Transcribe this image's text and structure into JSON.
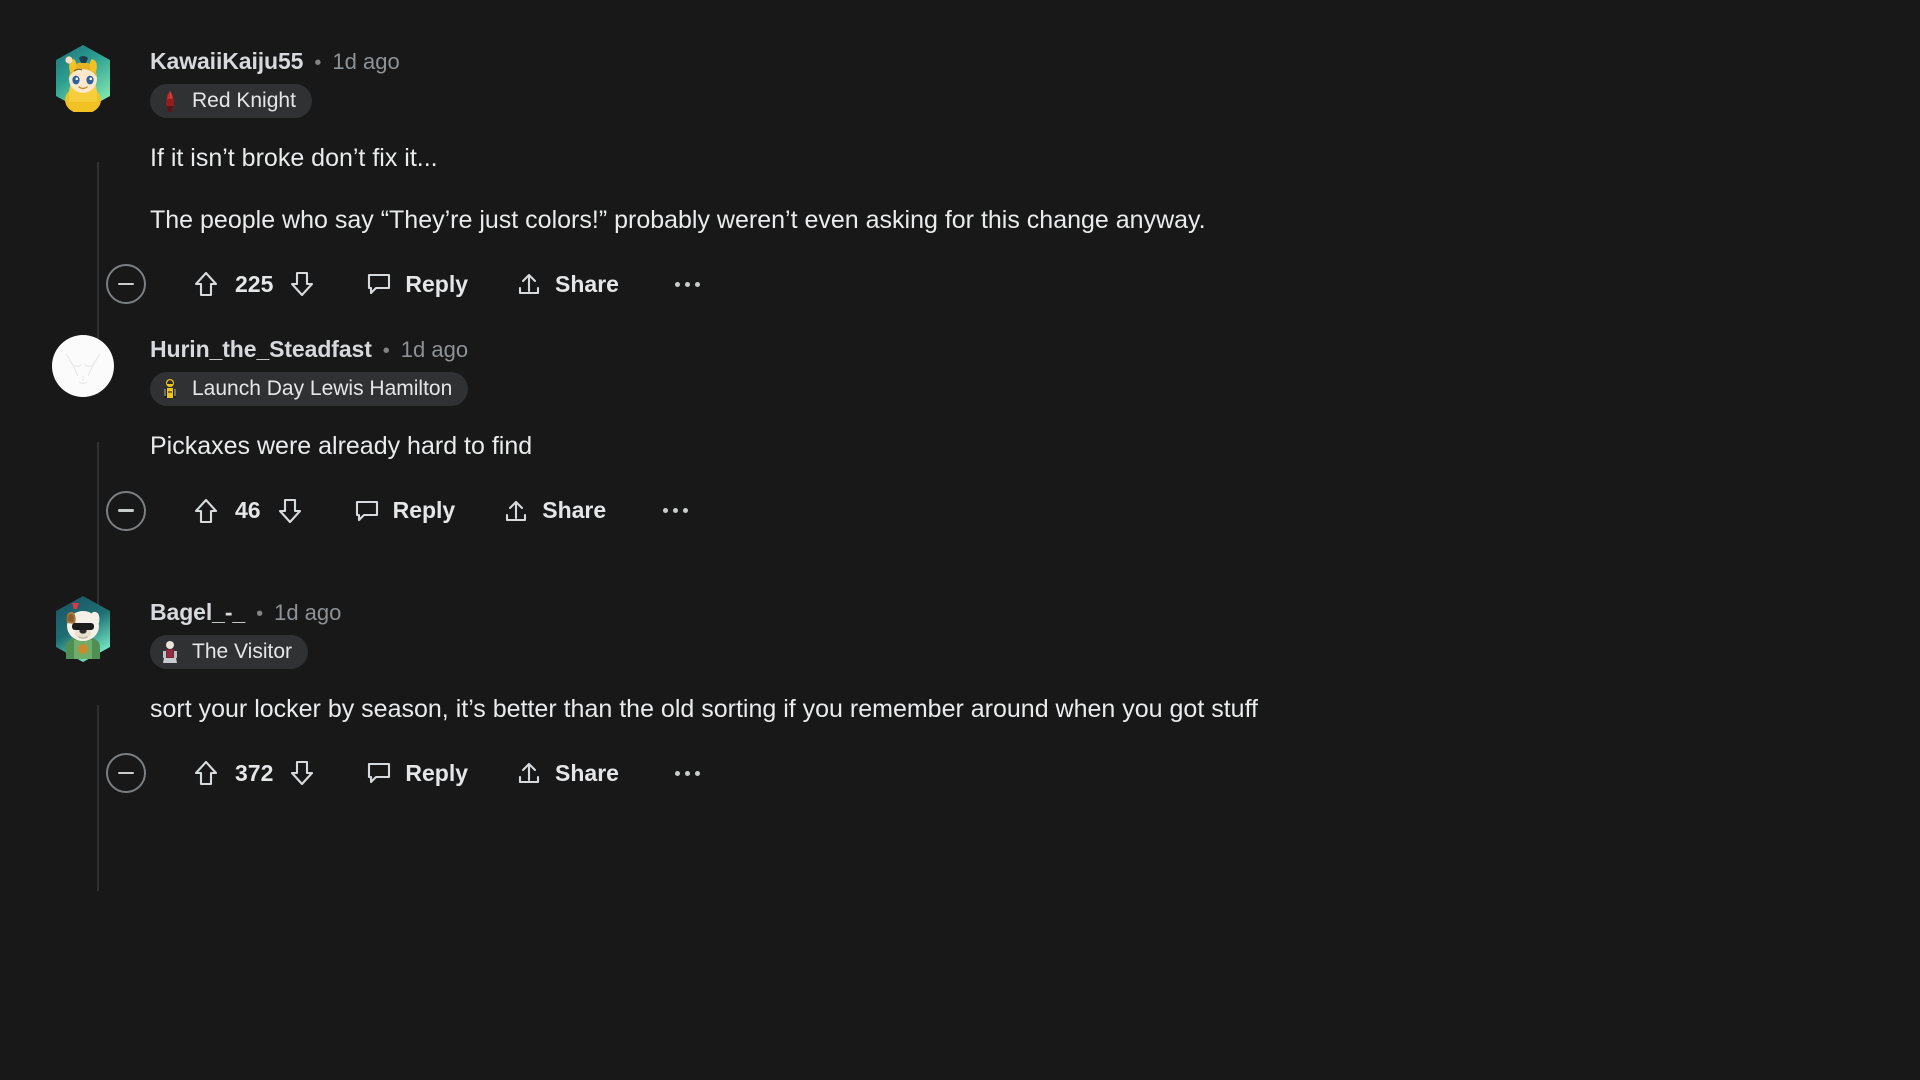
{
  "theme": {
    "background": "#181818",
    "text_primary": "#e9ebec",
    "text_secondary": "#8c9296",
    "flair_background": "#2f3133",
    "thread_line": "#2f3133"
  },
  "actions": {
    "collapse_label": "collapse-thread",
    "upvote_label": "upvote",
    "downvote_label": "downvote",
    "reply_label": "Reply",
    "share_label": "Share",
    "more_label": "more-options"
  },
  "comments": [
    {
      "username": "KawaiiKaiju55",
      "separator": "•",
      "timestamp": "1d ago",
      "flair": {
        "label": "Red Knight",
        "icon": "red-knight-icon"
      },
      "avatar": {
        "name": "kawaiikaiju55-avatar",
        "shape": "hexagon"
      },
      "paragraphs": [
        "If it isn’t broke don’t fix it...",
        "The people who say “They’re just colors!” probably weren’t even asking for this change anyway."
      ],
      "score": "225"
    },
    {
      "username": "Hurin_the_Steadfast",
      "separator": "•",
      "timestamp": "1d ago",
      "flair": {
        "label": "Launch Day Lewis Hamilton",
        "icon": "lewis-hamilton-icon"
      },
      "avatar": {
        "name": "hurin-the-steadfast-avatar",
        "shape": "circle"
      },
      "paragraphs": [
        "Pickaxes were already hard to find"
      ],
      "score": "46"
    },
    {
      "username": "Bagel_-_",
      "separator": "•",
      "timestamp": "1d ago",
      "flair": {
        "label": "The Visitor",
        "icon": "the-visitor-icon"
      },
      "avatar": {
        "name": "bagel-avatar",
        "shape": "hexagon"
      },
      "paragraphs": [
        "sort your locker by season, it’s better than the old sorting if you remember around when you got stuff"
      ],
      "score": "372"
    }
  ]
}
